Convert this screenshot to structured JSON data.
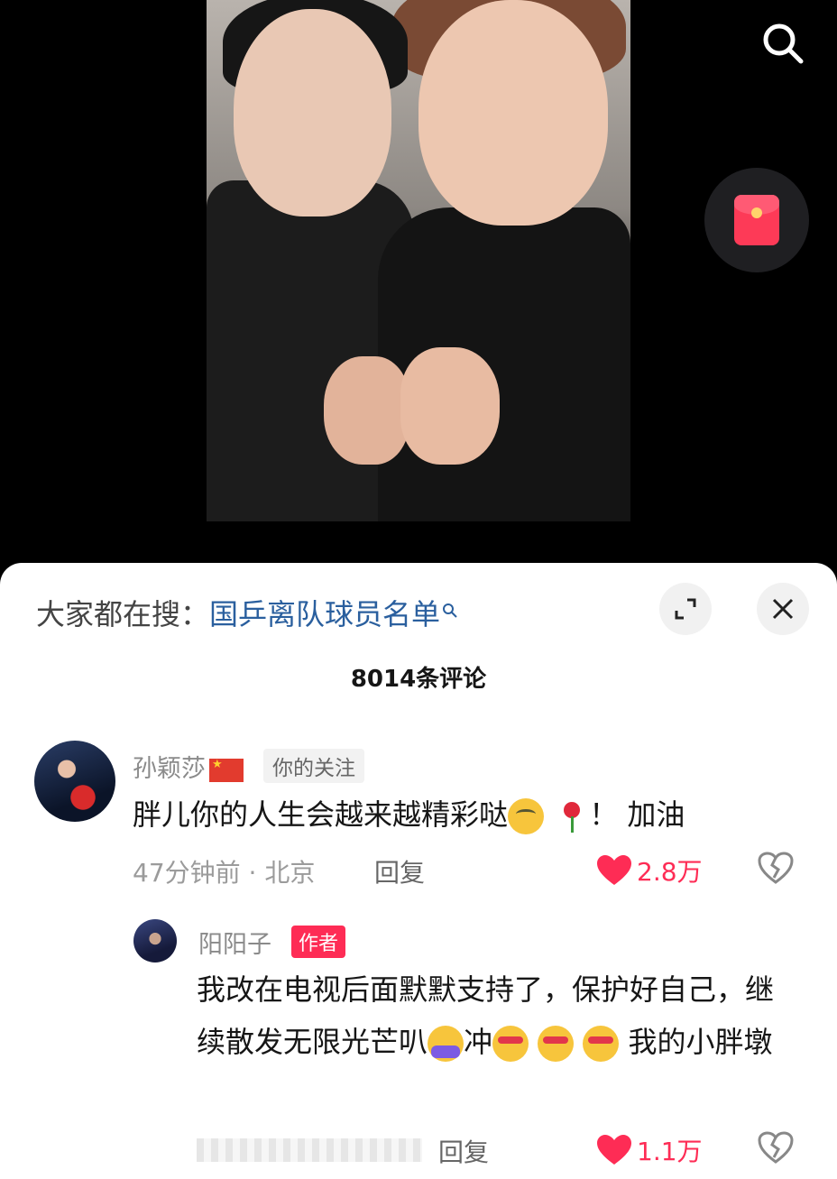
{
  "video": {
    "photo_alt": "two people fist bump selfie"
  },
  "top_actions": {
    "search_icon": "search-icon",
    "red_packet_icon": "red-packet-icon"
  },
  "trending": {
    "prefix": "大家都在搜：",
    "keyword": "国乒离队球员名单"
  },
  "comments_header": {
    "count_label": "8014条评论"
  },
  "comments": [
    {
      "author": "孙颖莎",
      "flag_icon": "china-flag-icon",
      "tag": "你的关注",
      "text": "胖儿你的人生会越来越精彩哒",
      "text_after_emoji": "！ 加油",
      "emojis": [
        "grin-emoji",
        "rose-emoji"
      ],
      "time_location": "47分钟前 · 北京",
      "reply_label": "回复",
      "likes": "2.8万"
    },
    {
      "author": "阳阳子",
      "tag": "作者",
      "text_part1": "我改在电视后面默默支持了，保护好自己，继续散发无限光芒叭",
      "text_part2": "冲",
      "text_part3": "我的小胖墩",
      "emojis": [
        "hug-emoji",
        "smug-emoji",
        "smug-emoji",
        "smug-emoji"
      ],
      "reply_label": "回复",
      "likes": "1.1万"
    }
  ],
  "colors": {
    "accent_red": "#fe2c55",
    "keyword_blue": "#2a5f9e"
  }
}
